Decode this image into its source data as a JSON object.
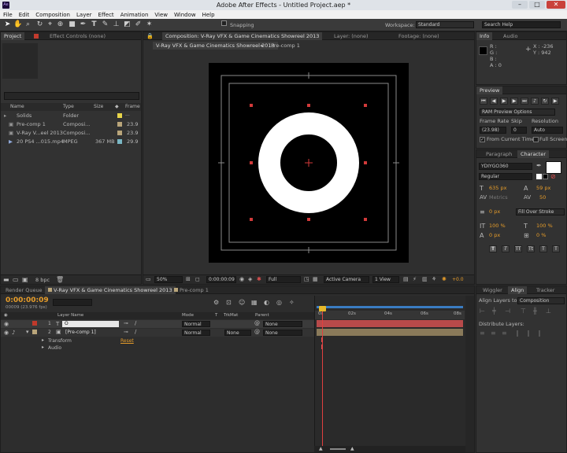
{
  "app": {
    "title": "Adobe After Effects - Untitled Project.aep *",
    "ae_icon": "ae-icon",
    "minimize": "–",
    "maximize": "□",
    "close": "✕"
  },
  "menu": [
    "File",
    "Edit",
    "Composition",
    "Layer",
    "Effect",
    "Animation",
    "View",
    "Window",
    "Help"
  ],
  "toolbar": {
    "snapping": "Snapping",
    "workspace_label": "Workspace:",
    "workspace_value": "Standard",
    "search_placeholder": "Search Help"
  },
  "project_panel": {
    "tab_project": "Project",
    "tab_effect_controls": "Effect Controls",
    "effect_controls_value": "(none)",
    "search_value": "",
    "columns": {
      "name": "Name",
      "type": "Type",
      "size": "Size",
      "frame": "Frame ..."
    },
    "items": [
      {
        "name": "Solids",
        "type": "Folder",
        "size": "",
        "fps": "",
        "color": "#e8d54a",
        "icon": "folder-icon"
      },
      {
        "name": "Pre-comp 1",
        "type": "Composi...",
        "size": "",
        "fps": "23.9",
        "color": "#b9a57a",
        "icon": "composition-icon"
      },
      {
        "name": "V-Ray V...eel 2013",
        "type": "Composi...",
        "size": "",
        "fps": "23.9",
        "color": "#b9a57a",
        "icon": "composition-icon"
      },
      {
        "name": "20 PS4 ...015.mp4",
        "type": "MPEG",
        "size": "367 MB",
        "fps": "29.9",
        "color": "#7ab7c4",
        "icon": "footage-icon"
      }
    ],
    "bpc": "8 bpc"
  },
  "composition_panel": {
    "tab_comp": "Composition: V-Ray VFX & Game Cinematics Showreel 2013",
    "tab_layer": "Layer: (none)",
    "tab_footage": "Footage: (none)",
    "breadcrumb_1": "V-Ray VFX & Game Cinematics Showreel 2013",
    "breadcrumb_2": "Pre-comp 1",
    "zoom": "50%",
    "timecode": "0:00:00:09",
    "resolution": "Full",
    "camera": "Active Camera",
    "view": "1 View",
    "exposure": "+0.0"
  },
  "info_panel": {
    "tab_info": "Info",
    "tab_audio": "Audio",
    "r": "R :",
    "g": "G :",
    "b": "B :",
    "a": "A : 0",
    "x": "X : -236",
    "y": "Y : 942"
  },
  "preview_panel": {
    "tab": "Preview",
    "options": "RAM Preview Options",
    "frame_rate_label": "Frame Rate",
    "skip_label": "Skip",
    "resolution_label": "Resolution",
    "frame_rate": "(23.98)",
    "skip": "0",
    "resolution": "Auto",
    "from_current": "From Current Time",
    "full_screen": "Full Screen"
  },
  "character_panel": {
    "tab_paragraph": "Paragraph",
    "tab_character": "Character",
    "font": "YDIYGO360",
    "style": "Regular",
    "size": "635 px",
    "leading": "59 px",
    "kerning": "Metrics",
    "tracking": "50",
    "stroke_width": "0 px",
    "stroke_mode": "Fill Over Stroke",
    "vert_scale": "100 %",
    "horiz_scale": "100 %",
    "baseline": "0 px",
    "tsume": "0 %",
    "style_buttons": [
      "T",
      "T",
      "TT",
      "Tt",
      "T",
      "T"
    ]
  },
  "timeline_panel": {
    "tab_render": "Render Queue",
    "tab_comp": "V-Ray VFX & Game Cinematics Showreel 2013",
    "tab_precomp": "Pre-comp 1",
    "timecode": "0:00:00:09",
    "frame_info": "00009 (23.976 fps)",
    "col_layer_name": "Layer Name",
    "col_mode": "Mode",
    "col_t": "T",
    "col_trkmat": "TrkMat",
    "col_parent": "Parent",
    "layers": [
      {
        "num": "1",
        "name": "O",
        "mode": "Normal",
        "trkmat": "",
        "parent": "None",
        "color": "#c0392b"
      },
      {
        "num": "2",
        "name": "[Pre-comp 1]",
        "mode": "Normal",
        "trkmat": "None",
        "parent": "None",
        "color": "#b9a57a"
      }
    ],
    "transform": "Transform",
    "reset": "Reset",
    "audio": "Audio",
    "ruler": [
      "0s",
      "02s",
      "04s",
      "06s",
      "08s"
    ]
  },
  "align_panel": {
    "tab_wiggler": "Wiggler",
    "tab_align": "Align",
    "tab_tracker": "Tracker",
    "align_to_label": "Align Layers to:",
    "align_to_value": "Composition",
    "distribute": "Distribute Layers:"
  }
}
